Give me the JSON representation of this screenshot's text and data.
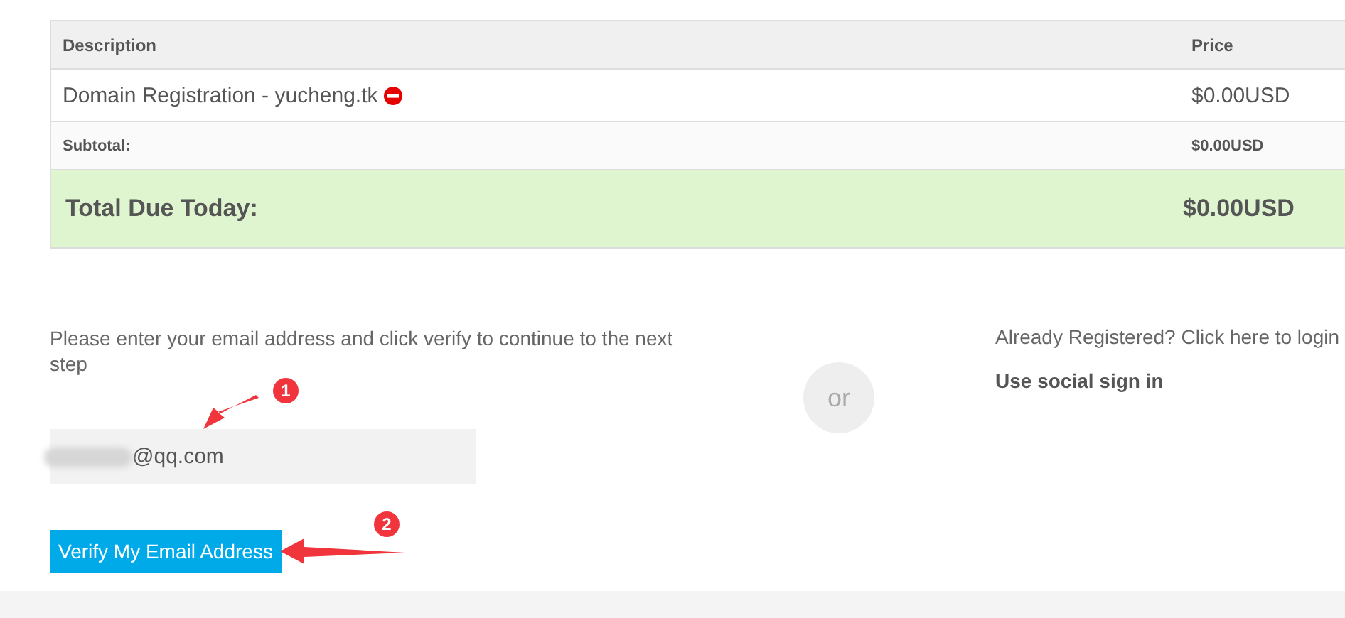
{
  "table": {
    "columns": [
      "Description",
      "Price"
    ],
    "rows": [
      {
        "kind": "item",
        "description": "Domain Registration - yucheng.tk",
        "price": "$0.00USD",
        "removable": true
      },
      {
        "kind": "subtotal",
        "description": "Subtotal:",
        "price": "$0.00USD"
      },
      {
        "kind": "total",
        "description": "Total Due Today:",
        "price": "$0.00USD"
      }
    ]
  },
  "email_form": {
    "instruction": "Please enter your email address and click verify to continue to the next step",
    "email": {
      "value": "@qq.com",
      "redacted": true
    },
    "verify_button": "Verify My Email Address"
  },
  "divider": "or",
  "login": {
    "link": "Already Registered? Click here to login",
    "social_heading": "Use social sign in"
  },
  "annotations": [
    {
      "number": "1"
    },
    {
      "number": "2"
    }
  ]
}
